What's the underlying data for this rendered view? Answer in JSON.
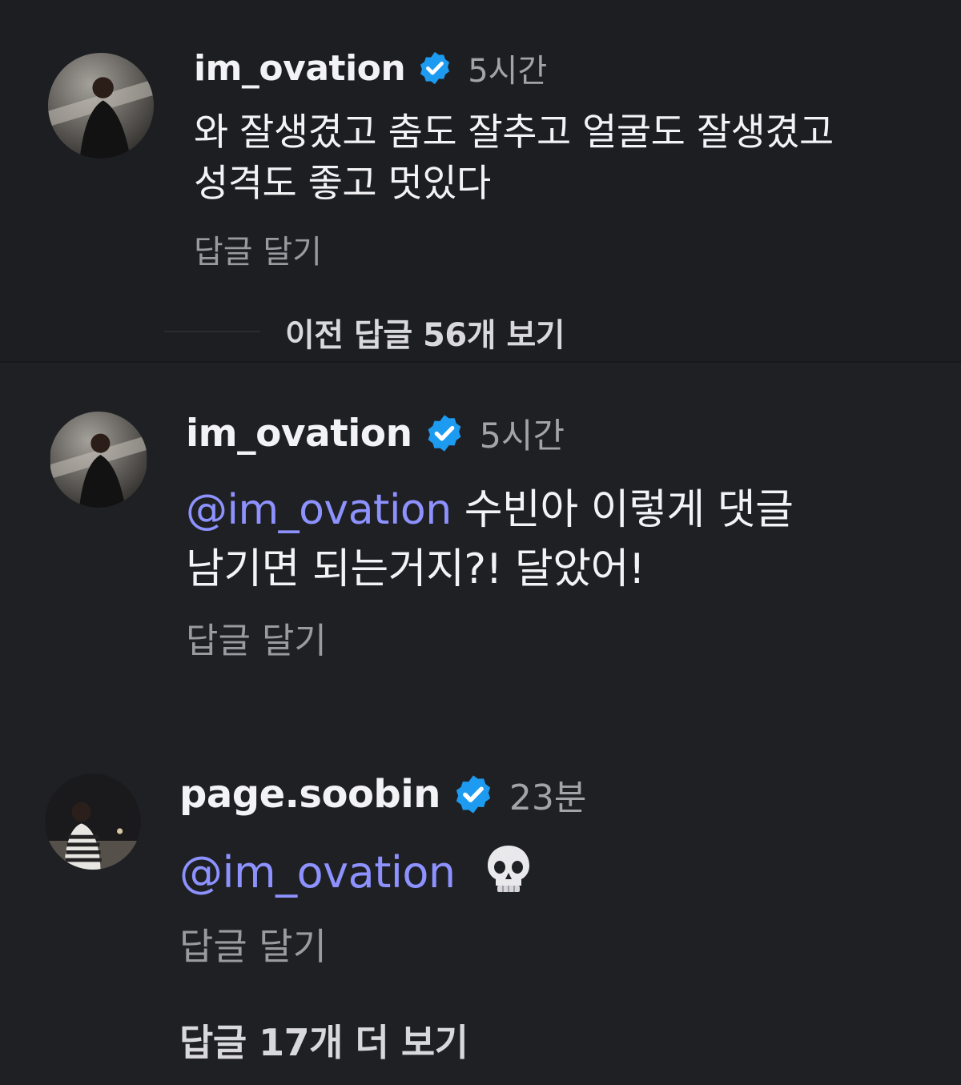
{
  "comments": [
    {
      "username": "im_ovation",
      "time": "5시간",
      "lines": [
        "와 잘생겼고 춤도 잘추고 얼굴도 잘생겼고",
        "성격도 좋고 멋있다"
      ],
      "reply_label": "답글 달기",
      "avatar_icon": "profile-photo"
    },
    {
      "username": "im_ovation",
      "time": "5시간",
      "mention": "@im_ovation",
      "line1_rest": " 수빈아  이렇게 댓글",
      "line2": "남기면 되는거지?! 달았어!",
      "reply_label": "답글 달기",
      "avatar_icon": "profile-photo"
    },
    {
      "username": "page.soobin",
      "time": "23분",
      "mention": "@im_ovation",
      "emoji": "💀",
      "reply_label": "답글 달기",
      "avatar_icon": "profile-photo"
    }
  ],
  "view_previous": "이전 답글 56개 보기",
  "view_more": "답글 17개 더 보기",
  "colors": {
    "background": "#1d1e22",
    "mention": "#8d92ff",
    "verified": "#1d9bf0",
    "secondary_text": "#9a9ba1"
  },
  "icons": [
    "verified-badge-icon",
    "threads-mention-icon",
    "skull-emoji"
  ]
}
